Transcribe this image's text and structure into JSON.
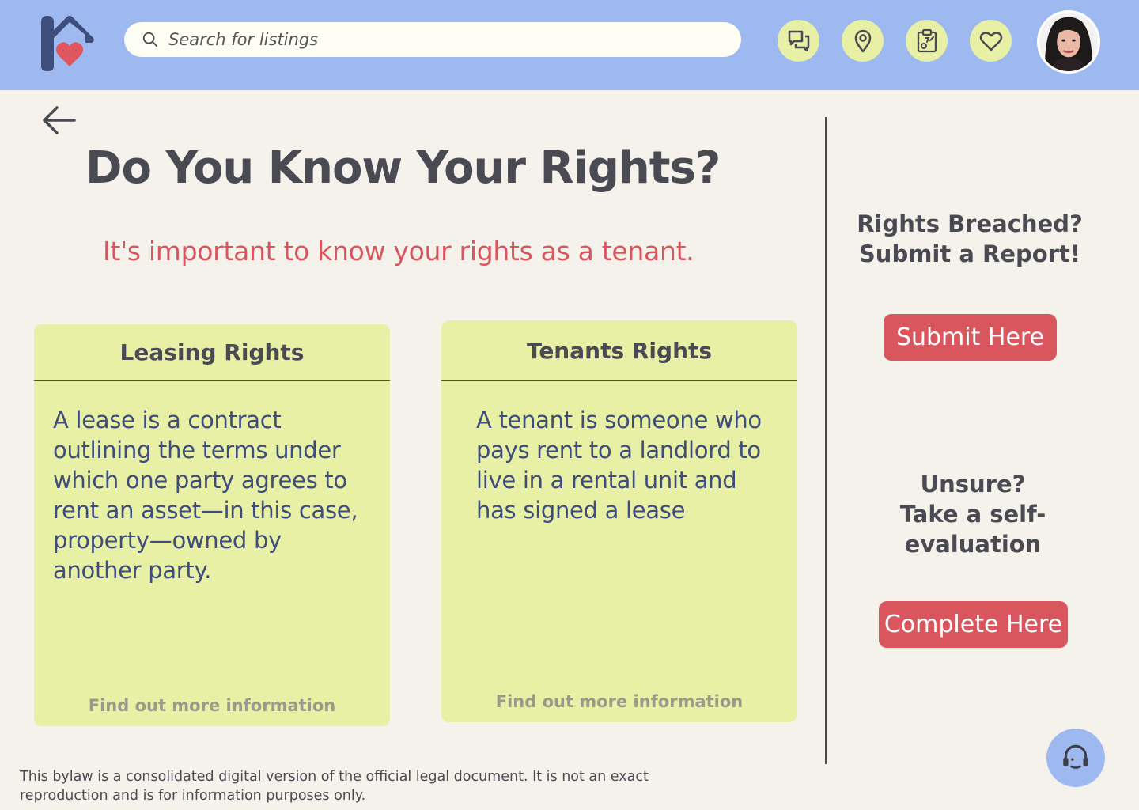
{
  "header": {
    "search_placeholder": "Search for listings",
    "icons": [
      "messages-icon",
      "location-pin-icon",
      "clipboard-map-icon",
      "heart-icon"
    ],
    "avatar": "user-avatar"
  },
  "page": {
    "title": "Do You Know Your Rights?",
    "subtitle": "It's important to know your rights as a tenant."
  },
  "cards": [
    {
      "title": "Leasing Rights",
      "body": "A lease is a contract outlining the terms under which one party agrees to rent an asset—in this case, property—owned by another party.",
      "link": "Find out more information"
    },
    {
      "title": "Tenants Rights",
      "body": "A tenant is someone who pays rent to a landlord to live in a rental unit and has signed a lease",
      "link": "Find out more information"
    }
  ],
  "sidebar": {
    "report_title": "Rights Breached? Submit a Report!",
    "report_button": "Submit Here",
    "eval_title": "Unsure? Take a self-evaluation",
    "eval_button": "Complete Here"
  },
  "footer": {
    "disclaimer": "This bylaw is a consolidated digital version of the official legal document. It is not an exact reproduction and is for information purposes only."
  },
  "colors": {
    "header_bg": "#9eb9ef",
    "card_bg": "#e8f0a6",
    "accent": "#d9565f",
    "page_bg": "#f5f2ec"
  }
}
